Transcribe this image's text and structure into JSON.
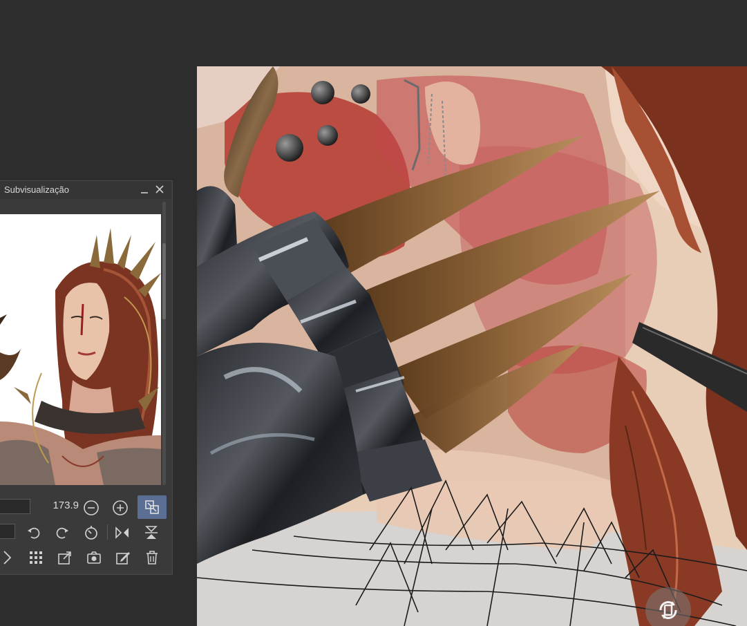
{
  "subview_panel": {
    "title": "Subvisualização",
    "zoom_value": "173.9"
  },
  "icons": {
    "minimize": "minimize-icon",
    "close": "close-icon",
    "zoom_out": "zoom-out-icon",
    "zoom_in": "zoom-in-icon",
    "fit_view": "fit-view-icon",
    "rotate_left": "rotate-left-icon",
    "rotate_right": "rotate-right-icon",
    "reset_rotation": "reset-rotation-icon",
    "flip_horizontal": "flip-horizontal-icon",
    "flip_vertical": "flip-vertical-icon",
    "next": "chevron-right-icon",
    "grid": "grid-icon",
    "import": "import-icon",
    "snapshot": "camera-icon",
    "edit": "edit-icon",
    "delete": "trash-icon",
    "canvas_reset_rotation": "rotate-reset-icon"
  },
  "colors": {
    "workspace_bg": "#2d2d2d",
    "panel_bg": "#3a3a3a",
    "accent": "#5b6e93"
  }
}
